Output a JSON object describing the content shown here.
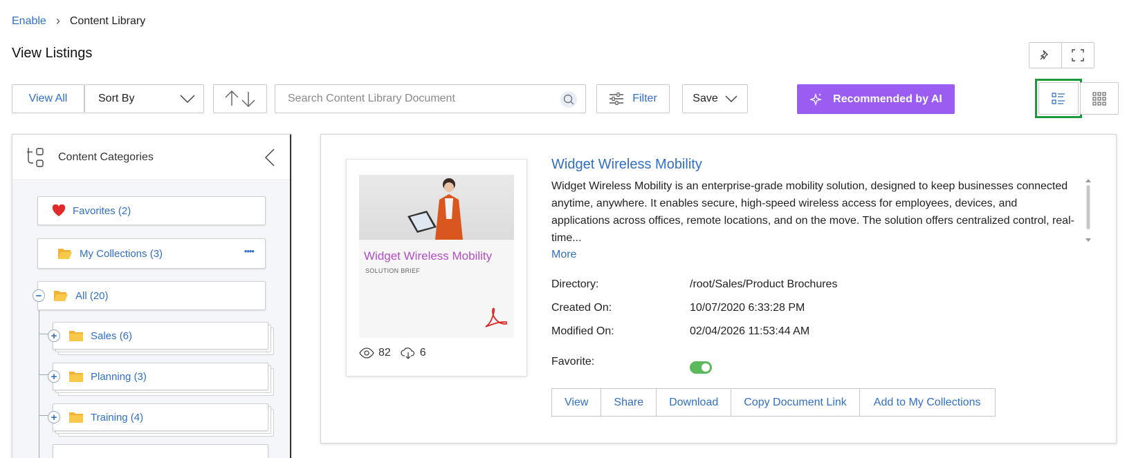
{
  "breadcrumb": {
    "root": "Enable",
    "current": "Content Library"
  },
  "page_title": "View Listings",
  "toolbar": {
    "view_all": "View All",
    "sort_by": "Sort By",
    "search_placeholder": "Search Content Library Document",
    "filter": "Filter",
    "save": "Save",
    "recommended_ai": "Recommended by AI"
  },
  "categories": {
    "title": "Content Categories",
    "favorites": "Favorites (2)",
    "my_collections": "My Collections (3)",
    "my_collections_menu": "••••",
    "all": "All (20)",
    "sales": "Sales (6)",
    "planning": "Planning (3)",
    "training": "Training (4)"
  },
  "document": {
    "title": "Widget Wireless Mobility",
    "thumb_title": "Widget Wireless Mobility",
    "thumb_subtitle": "SOLUTION BRIEF",
    "views": "82",
    "downloads": "6",
    "description": "Widget Wireless Mobility is an enterprise-grade mobility solution, designed to keep businesses connected anytime, anywhere. It enables secure, high-speed wireless access for employees, devices, and applications across offices, remote locations, and on the move. The solution offers centralized control, real-time...",
    "more": "More",
    "directory_label": "Directory:",
    "directory": "/root/Sales/Product Brochures",
    "created_label": "Created On:",
    "created": "10/07/2020 6:33:28 PM",
    "modified_label": "Modified On:",
    "modified": "02/04/2026 11:53:44 AM",
    "favorite_label": "Favorite:",
    "favorite": true
  },
  "actions": {
    "view": "View",
    "share": "Share",
    "download": "Download",
    "copy_link": "Copy Document Link",
    "add_collections": "Add to My Collections"
  },
  "colors": {
    "link": "#2f6fc7",
    "ai": "#9b5cf2",
    "selected_border": "#1a9a3c",
    "toggle_on": "#5cb85c"
  }
}
